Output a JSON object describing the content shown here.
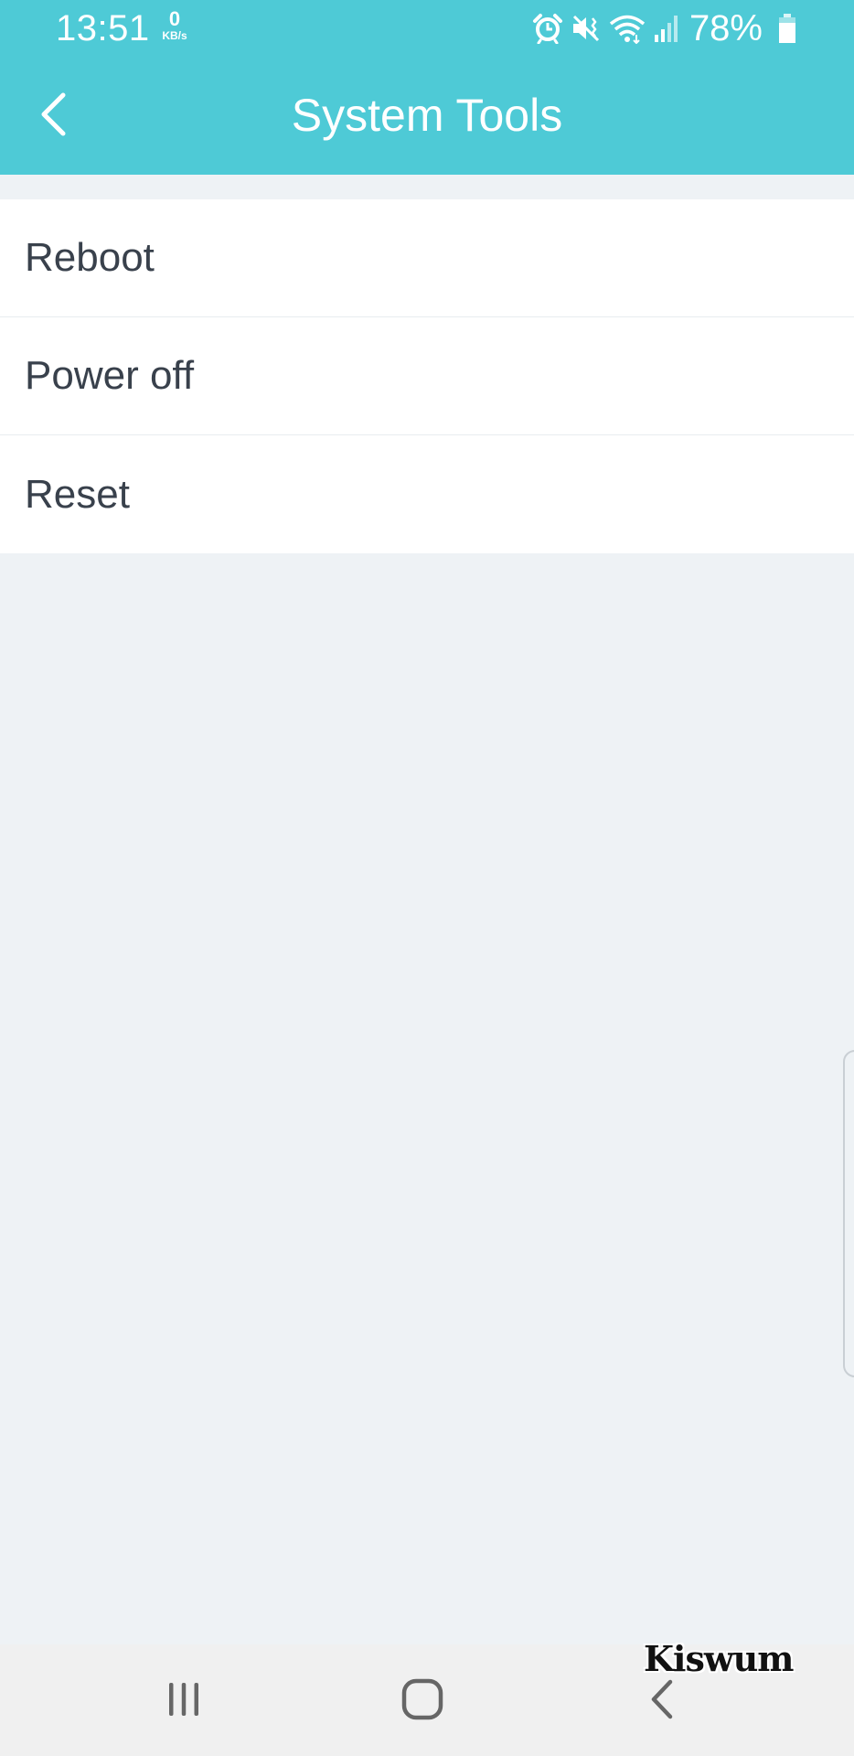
{
  "status_bar": {
    "time": "13:51",
    "net_speed_value": "0",
    "net_speed_unit": "KB/s",
    "icons": [
      "alarm-icon",
      "vibrate-mute-icon",
      "wifi-icon",
      "signal-icon"
    ],
    "battery_percent": "78%",
    "battery_level": 0.78
  },
  "header": {
    "title": "System Tools",
    "back_icon": "chevron-left-icon",
    "background_color": "#4ecad6"
  },
  "menu": {
    "items": [
      {
        "label": "Reboot"
      },
      {
        "label": "Power off"
      },
      {
        "label": "Reset"
      }
    ]
  },
  "nav_bar": {
    "icons": [
      "recents-icon",
      "home-icon",
      "back-icon"
    ]
  },
  "watermark": "Kiswum"
}
